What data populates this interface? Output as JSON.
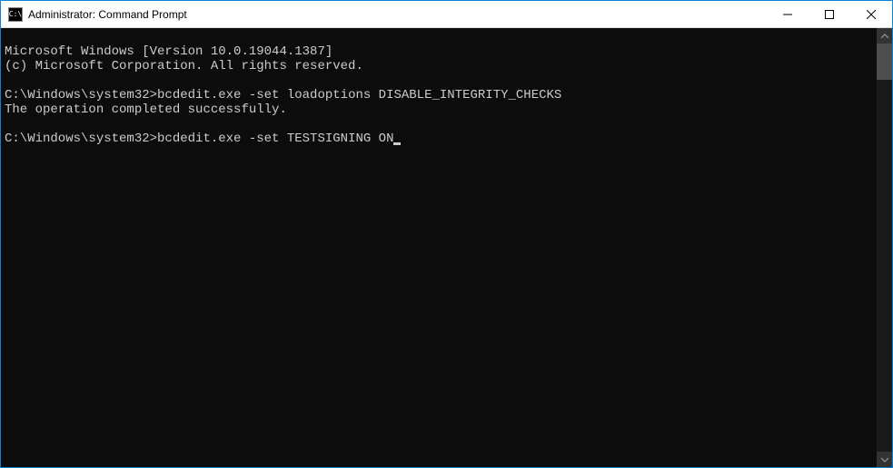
{
  "titlebar": {
    "icon_label": "C:\\",
    "title": "Administrator: Command Prompt"
  },
  "window_controls": {
    "minimize": "−",
    "maximize": "☐",
    "close": "✕"
  },
  "terminal": {
    "lines": {
      "l0": "Microsoft Windows [Version 10.0.19044.1387]",
      "l1": "(c) Microsoft Corporation. All rights reserved.",
      "l2": "",
      "l3_prompt": "C:\\Windows\\system32>",
      "l3_cmd": "bcdedit.exe -set loadoptions DISABLE_INTEGRITY_CHECKS",
      "l4": "The operation completed successfully.",
      "l5": "",
      "l6_prompt": "C:\\Windows\\system32>",
      "l6_cmd": "bcdedit.exe -set TESTSIGNING ON"
    }
  },
  "scrollbar": {
    "up": "▲",
    "down": "▼"
  }
}
